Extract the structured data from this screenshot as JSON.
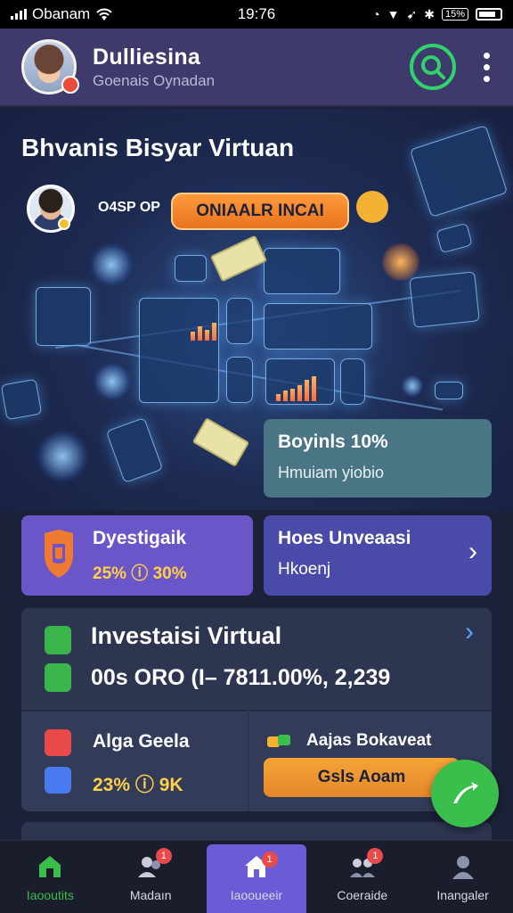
{
  "status_bar": {
    "carrier": "Obanam",
    "time": "19:76",
    "battery_label": "15%"
  },
  "header": {
    "title": "Dulliesina",
    "subtitle": "Goenais Oynadan",
    "accent_color": "#2fd36c",
    "icons": [
      "search-icon",
      "more-vertical-icon"
    ]
  },
  "hero": {
    "title": "Bhvanis Bisyar Virtuan",
    "stat": "O4SP OP",
    "cta_label": "ONIAALR INCAI"
  },
  "bonus": {
    "title": "Boyinls 10%",
    "subtitle": "Hmuiam yiobio"
  },
  "cards": [
    {
      "title": "Dyestigaik",
      "value": "25% ⓘ 30%",
      "icon": "shield-icon",
      "color": "#6b56c9"
    },
    {
      "title": "Hoes Unveaasi",
      "subtitle": "Hkoenj",
      "icon": "chevron-right-icon",
      "color": "#4a4aa8"
    }
  ],
  "investment": {
    "title": "Investaisi Virtual",
    "stat": "00s ORO (I– 7811.00%, 2,239",
    "left": {
      "title": "Alga Geela",
      "value": "23% ⓘ 9K"
    },
    "right": {
      "title": "Aajas Bokaveat",
      "button_label": "Gsls Aoam"
    }
  },
  "tabs": [
    {
      "label": "Iaooutits",
      "icon": "home-icon",
      "badge": "",
      "active": false,
      "highlight": true
    },
    {
      "label": "Madaın",
      "icon": "people-icon",
      "badge": "1",
      "active": false
    },
    {
      "label": "Iaooueeir",
      "icon": "house-icon",
      "badge": "1",
      "active": true
    },
    {
      "label": "Coeraide",
      "icon": "group-icon",
      "badge": "1",
      "active": false
    },
    {
      "label": "Inangaler",
      "icon": "user-icon",
      "badge": "",
      "active": false
    }
  ]
}
